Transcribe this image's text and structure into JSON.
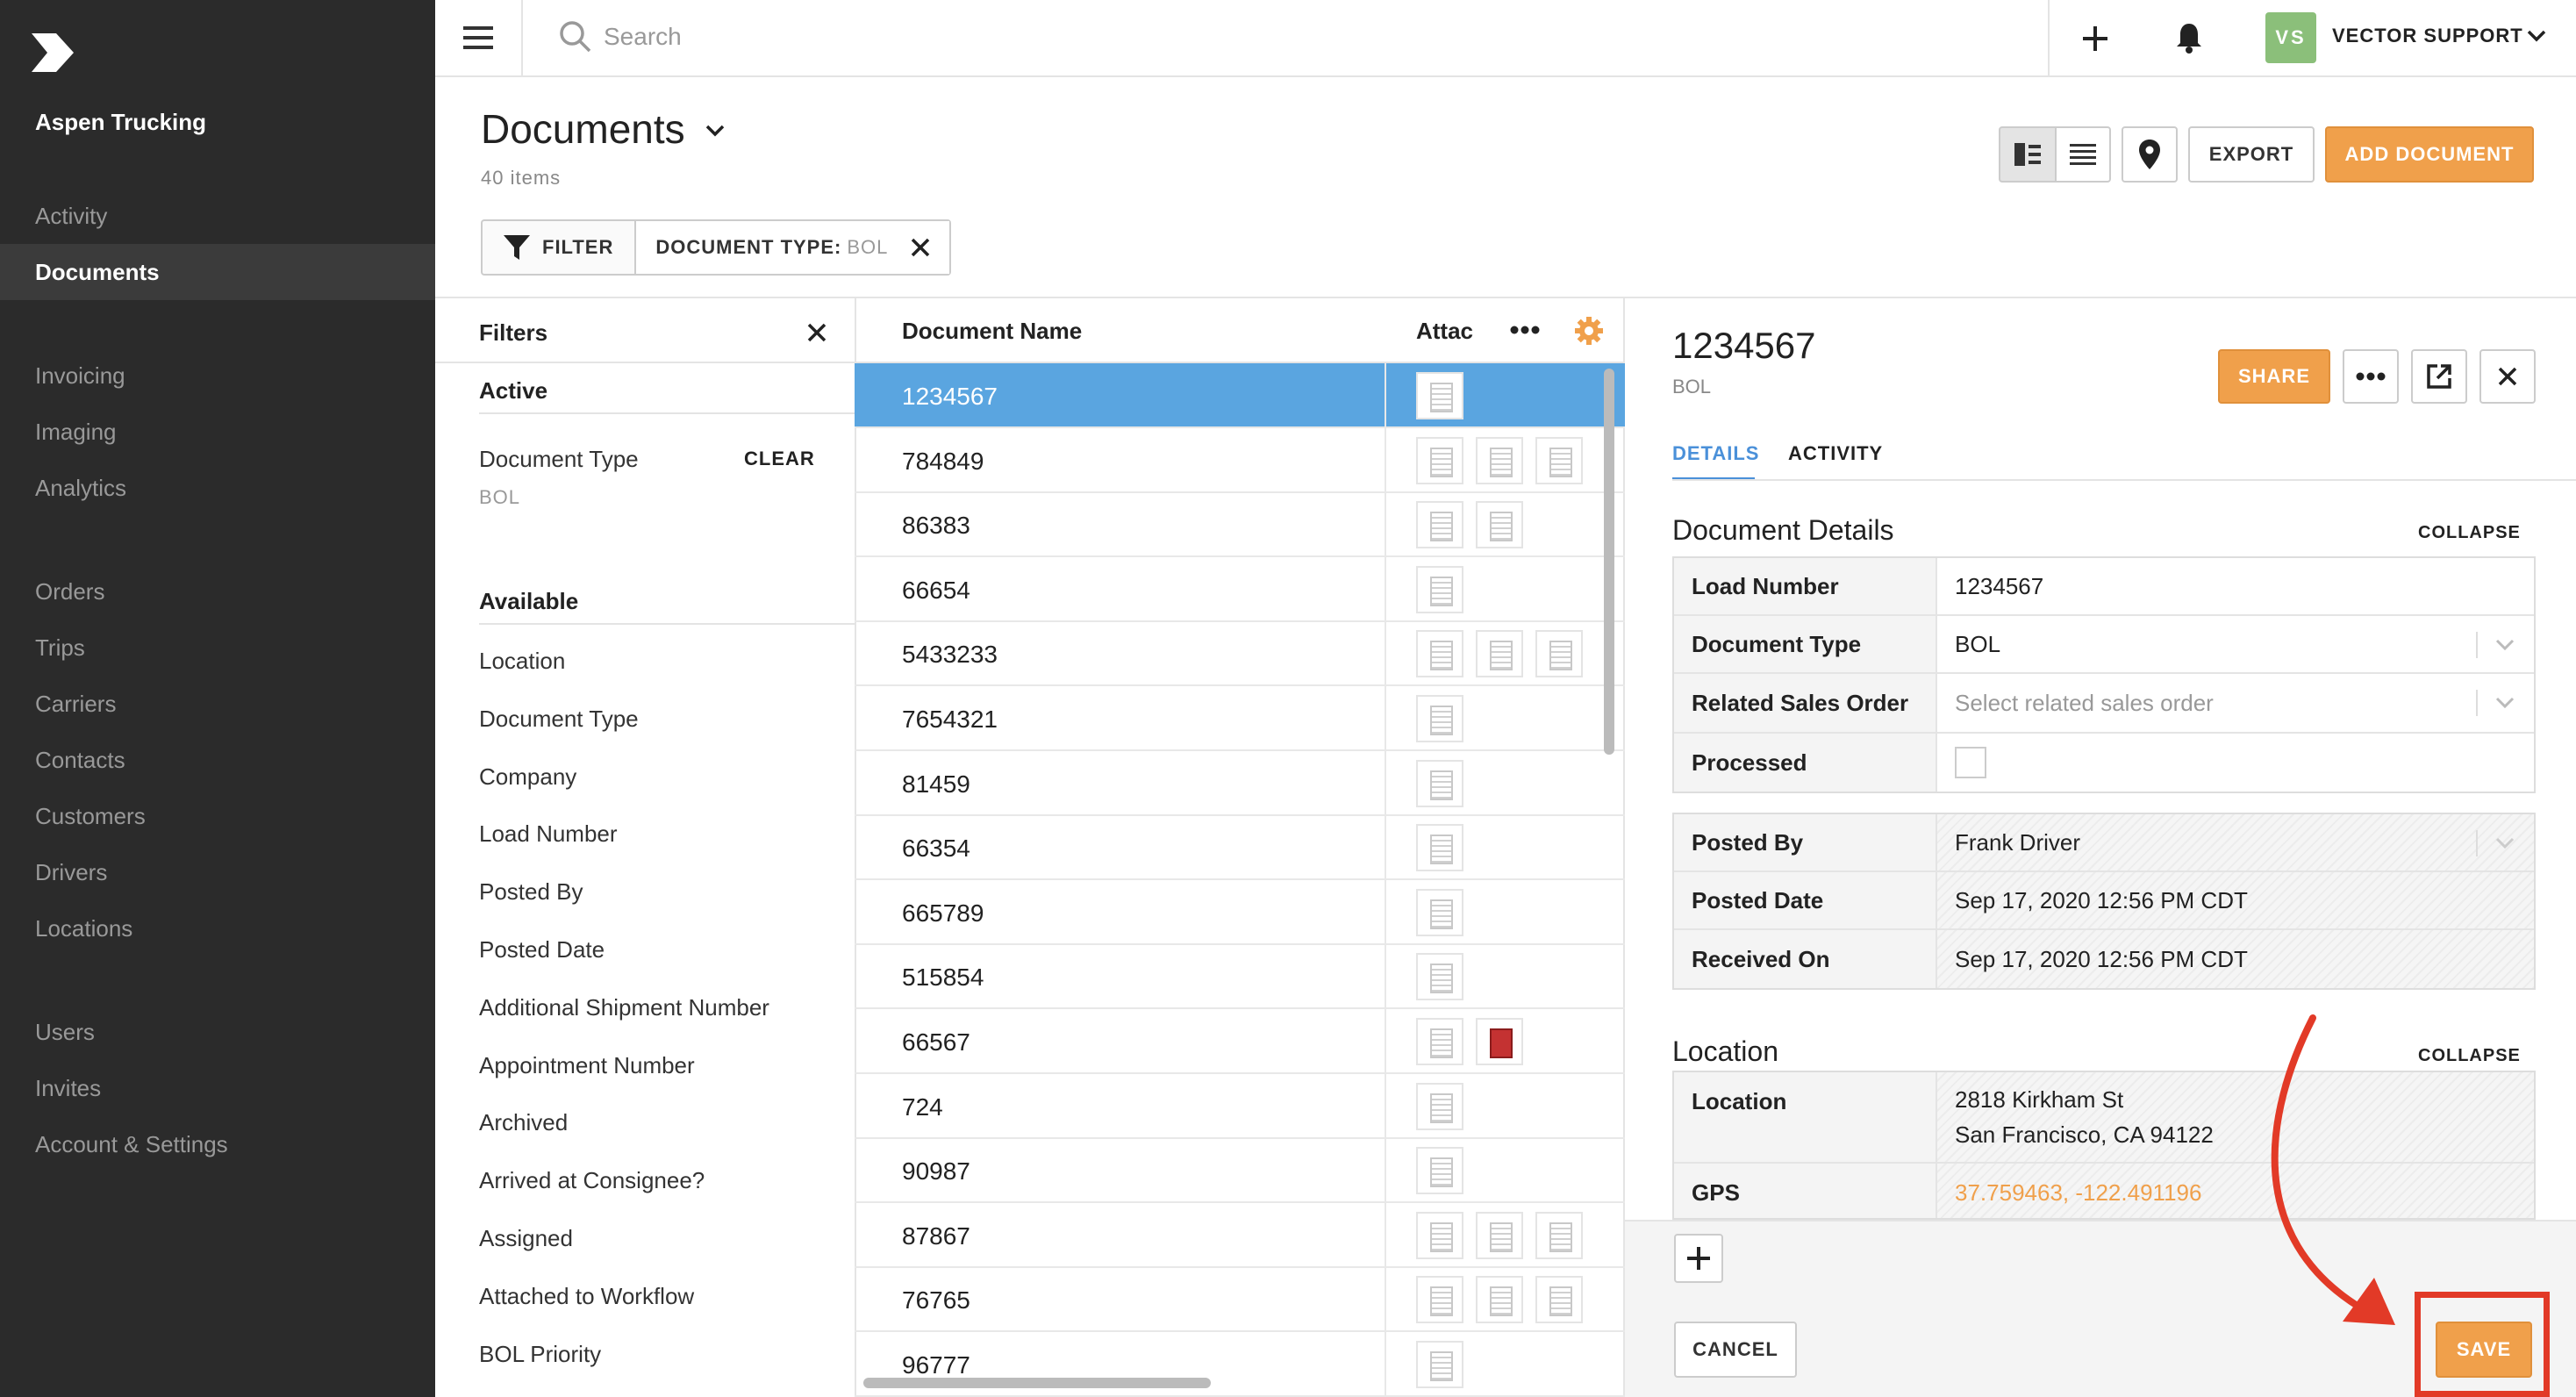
{
  "app": {
    "company": "Aspen Trucking",
    "accent": "#f0a04b",
    "selected_row_color": "#5aa5e0"
  },
  "sidebar": {
    "items": [
      {
        "label": "Activity",
        "active": false
      },
      {
        "label": "Documents",
        "active": true
      },
      {
        "label": "Invoicing",
        "active": false
      },
      {
        "label": "Imaging",
        "active": false
      },
      {
        "label": "Analytics",
        "active": false
      },
      {
        "label": "Orders",
        "active": false
      },
      {
        "label": "Trips",
        "active": false
      },
      {
        "label": "Carriers",
        "active": false
      },
      {
        "label": "Contacts",
        "active": false
      },
      {
        "label": "Customers",
        "active": false
      },
      {
        "label": "Drivers",
        "active": false
      },
      {
        "label": "Locations",
        "active": false
      },
      {
        "label": "Users",
        "active": false
      },
      {
        "label": "Invites",
        "active": false
      },
      {
        "label": "Account & Settings",
        "active": false
      }
    ]
  },
  "topbar": {
    "search_placeholder": "Search",
    "avatar_initials": "VS",
    "user_name": "VECTOR SUPPORT"
  },
  "page": {
    "title": "Documents",
    "item_count": "40 items",
    "export_label": "EXPORT",
    "add_document_label": "ADD DOCUMENT",
    "filter_label": "FILTER",
    "chip_key": "DOCUMENT TYPE:",
    "chip_value": "BOL"
  },
  "filters_panel": {
    "title": "Filters",
    "active_heading": "Active",
    "active_filter_label": "Document Type",
    "active_filter_value": "BOL",
    "clear_label": "CLEAR",
    "available_heading": "Available",
    "available": [
      "Location",
      "Document Type",
      "Company",
      "Load Number",
      "Posted By",
      "Posted Date",
      "Additional Shipment Number",
      "Appointment Number",
      "Archived",
      "Arrived at Consignee?",
      "Assigned",
      "Attached to Workflow",
      "BOL Priority"
    ]
  },
  "doc_list": {
    "col_name": "Document Name",
    "col_attach": "Attachi",
    "rows": [
      {
        "name": "1234567",
        "attachments": 1,
        "pdf": false
      },
      {
        "name": "784849",
        "attachments": 3,
        "pdf": false
      },
      {
        "name": "86383",
        "attachments": 2,
        "pdf": false
      },
      {
        "name": "66654",
        "attachments": 1,
        "pdf": false
      },
      {
        "name": "5433233",
        "attachments": 3,
        "pdf": false
      },
      {
        "name": "7654321",
        "attachments": 1,
        "pdf": false
      },
      {
        "name": "81459",
        "attachments": 1,
        "pdf": false
      },
      {
        "name": "66354",
        "attachments": 1,
        "pdf": false
      },
      {
        "name": "665789",
        "attachments": 1,
        "pdf": false
      },
      {
        "name": "515854",
        "attachments": 1,
        "pdf": false
      },
      {
        "name": "66567",
        "attachments": 2,
        "pdf": true
      },
      {
        "name": "724",
        "attachments": 1,
        "pdf": false
      },
      {
        "name": "90987",
        "attachments": 1,
        "pdf": false
      },
      {
        "name": "87867",
        "attachments": 3,
        "pdf": false
      },
      {
        "name": "76765",
        "attachments": 3,
        "pdf": false
      },
      {
        "name": "96777",
        "attachments": 1,
        "pdf": false
      }
    ]
  },
  "detail": {
    "title": "1234567",
    "subtitle": "BOL",
    "share_label": "SHARE",
    "tab_details": "DETAILS",
    "tab_activity": "ACTIVITY",
    "doc_details_title": "Document Details",
    "collapse_label": "COLLAPSE",
    "fields": {
      "load_number_label": "Load Number",
      "load_number": "1234567",
      "doc_type_label": "Document Type",
      "doc_type": "BOL",
      "related_label": "Related Sales Order",
      "related_placeholder": "Select related sales order",
      "processed_label": "Processed",
      "posted_by_label": "Posted By",
      "posted_by": "Frank Driver",
      "posted_date_label": "Posted Date",
      "posted_date": "Sep 17, 2020 12:56 PM CDT",
      "received_label": "Received On",
      "received_on": "Sep 17, 2020 12:56 PM CDT"
    },
    "location_title": "Location",
    "location": {
      "location_label": "Location",
      "address_line1": "2818 Kirkham St",
      "address_line2": "San Francisco, CA 94122",
      "gps_label": "GPS",
      "gps": "37.759463, -122.491196"
    },
    "cancel_label": "CANCEL",
    "save_label": "SAVE"
  }
}
